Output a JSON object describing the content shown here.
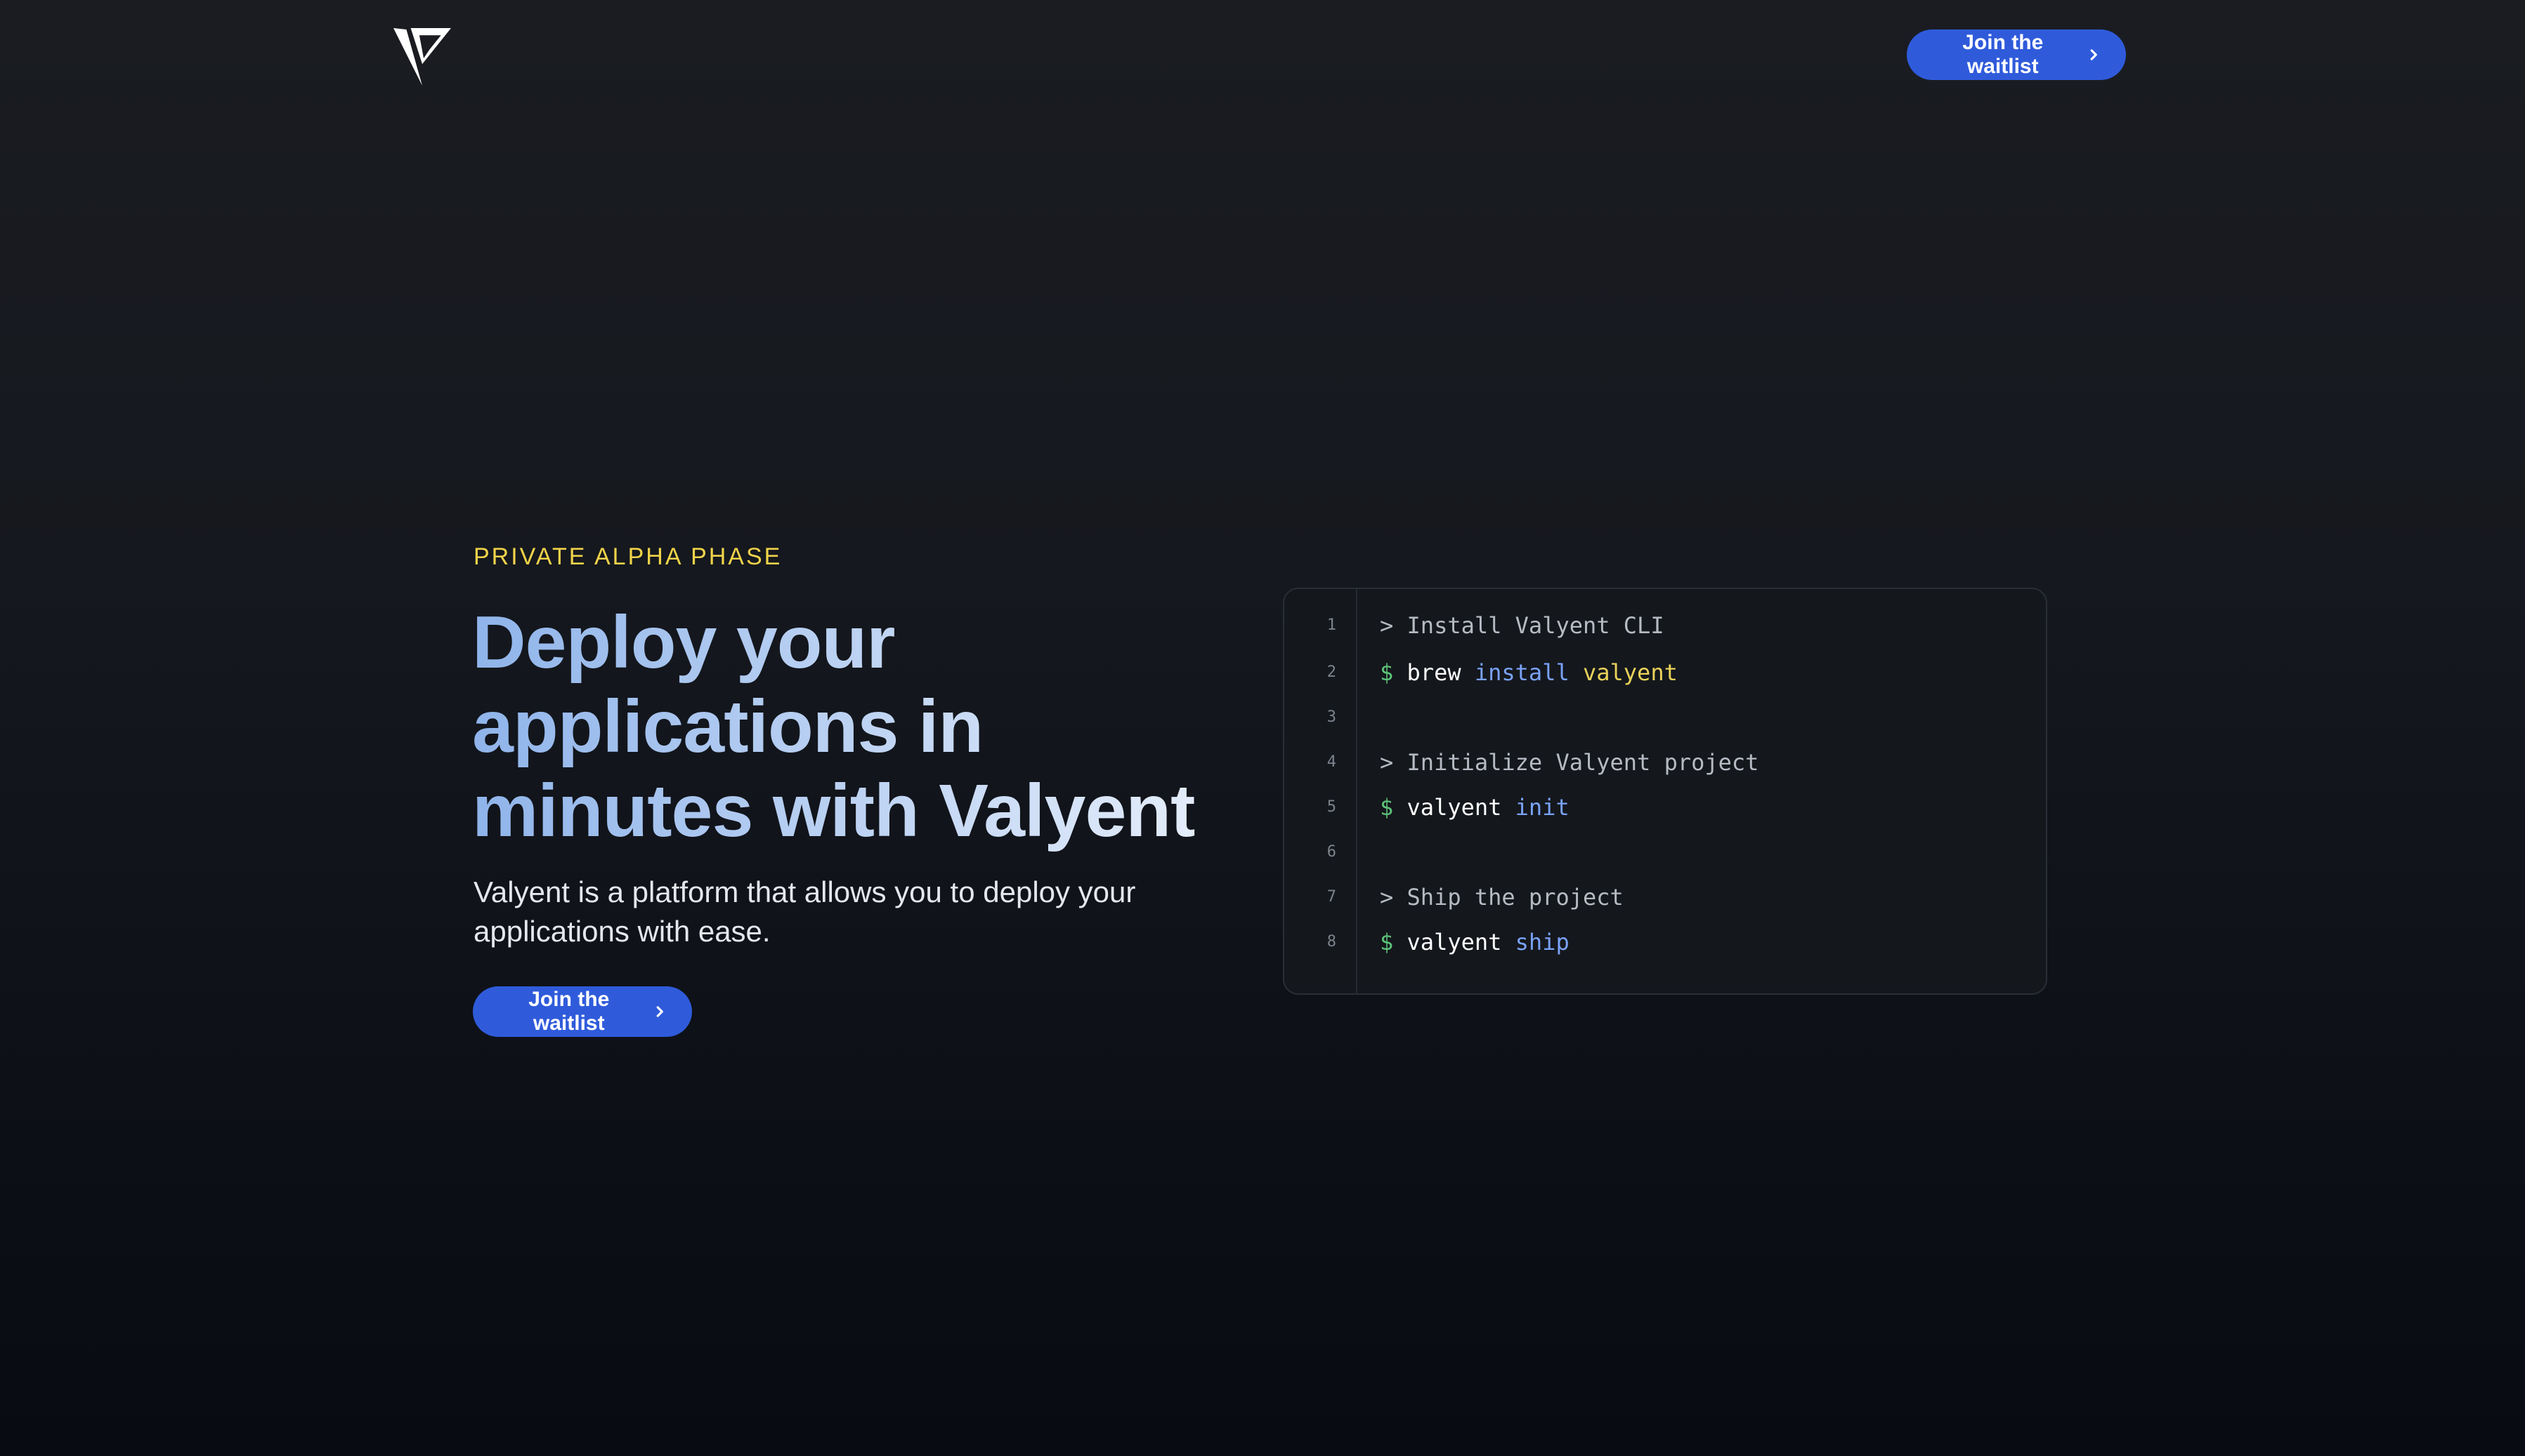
{
  "header": {
    "logo_alt": "Valyent logo",
    "cta_label": "Join the waitlist"
  },
  "hero": {
    "eyebrow": "PRIVATE ALPHA PHASE",
    "headline": "Deploy your applications in minutes with Valyent",
    "description": "Valyent is a platform that allows you to deploy your applications with ease.",
    "cta_label": "Join the waitlist"
  },
  "colors": {
    "accent": "#2f5bdb",
    "eyebrow": "#f1d34a",
    "prompt": "#5ec47a",
    "keyword": "#7aa2f7",
    "argument": "#e9d25a"
  },
  "icons": {
    "logo": "valyent-logo-icon",
    "cta_chevron": "chevron-right-icon"
  },
  "code_panel": {
    "lines": [
      {
        "number": "1",
        "comment": "> Install Valyent CLI"
      },
      {
        "number": "2",
        "prompt": "$",
        "cmd": "brew",
        "kw": "install",
        "arg": "valyent"
      },
      {
        "number": "3"
      },
      {
        "number": "4",
        "comment": "> Initialize Valyent project"
      },
      {
        "number": "5",
        "prompt": "$",
        "cmd": "valyent",
        "kw": "init"
      },
      {
        "number": "6"
      },
      {
        "number": "7",
        "comment": "> Ship the project"
      },
      {
        "number": "8",
        "prompt": "$",
        "cmd": "valyent",
        "kw": "ship"
      }
    ]
  }
}
